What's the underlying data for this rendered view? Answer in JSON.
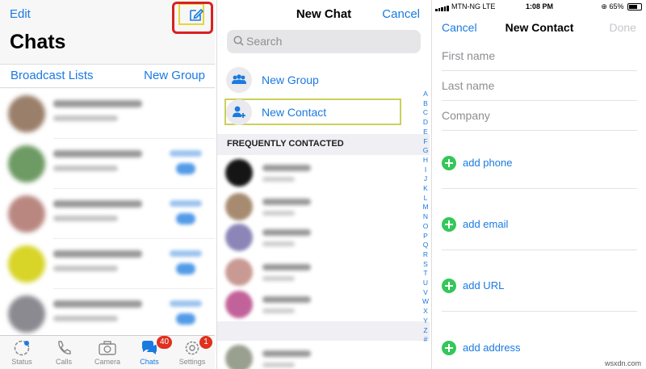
{
  "chats_panel": {
    "edit_label": "Edit",
    "title": "Chats",
    "broadcast_label": "Broadcast Lists",
    "new_group_label": "New Group",
    "compose_icon": "compose-icon",
    "tabs": [
      {
        "label": "Status",
        "icon": "status-icon",
        "badge": ""
      },
      {
        "label": "Calls",
        "icon": "calls-icon",
        "badge": ""
      },
      {
        "label": "Camera",
        "icon": "camera-icon",
        "badge": ""
      },
      {
        "label": "Chats",
        "icon": "chats-icon",
        "badge": "40"
      },
      {
        "label": "Settings",
        "icon": "settings-icon",
        "badge": "1"
      }
    ]
  },
  "new_chat_panel": {
    "title": "New Chat",
    "cancel_label": "Cancel",
    "search_placeholder": "Search",
    "new_group_label": "New Group",
    "new_contact_label": "New Contact",
    "section_label": "FREQUENTLY CONTACTED",
    "index_letters": [
      "A",
      "B",
      "C",
      "D",
      "E",
      "F",
      "G",
      "H",
      "I",
      "J",
      "K",
      "L",
      "M",
      "N",
      "O",
      "P",
      "Q",
      "R",
      "S",
      "T",
      "U",
      "V",
      "W",
      "X",
      "Y",
      "Z",
      "#"
    ]
  },
  "new_contact_panel": {
    "status_bar": {
      "carrier": "MTN-NG",
      "network": "LTE",
      "time": "1:08 PM",
      "battery": "65%"
    },
    "cancel_label": "Cancel",
    "title": "New Contact",
    "done_label": "Done",
    "first_name_placeholder": "First name",
    "last_name_placeholder": "Last name",
    "company_placeholder": "Company",
    "add_phone_label": "add phone",
    "add_email_label": "add email",
    "add_url_label": "add URL",
    "add_address_label": "add address"
  },
  "colors": {
    "accent": "#1a7ae0",
    "highlight_red": "#d9211f",
    "highlight_yellow": "#cbd05a",
    "add_green": "#34c759"
  },
  "watermark": "wsxdn.com"
}
